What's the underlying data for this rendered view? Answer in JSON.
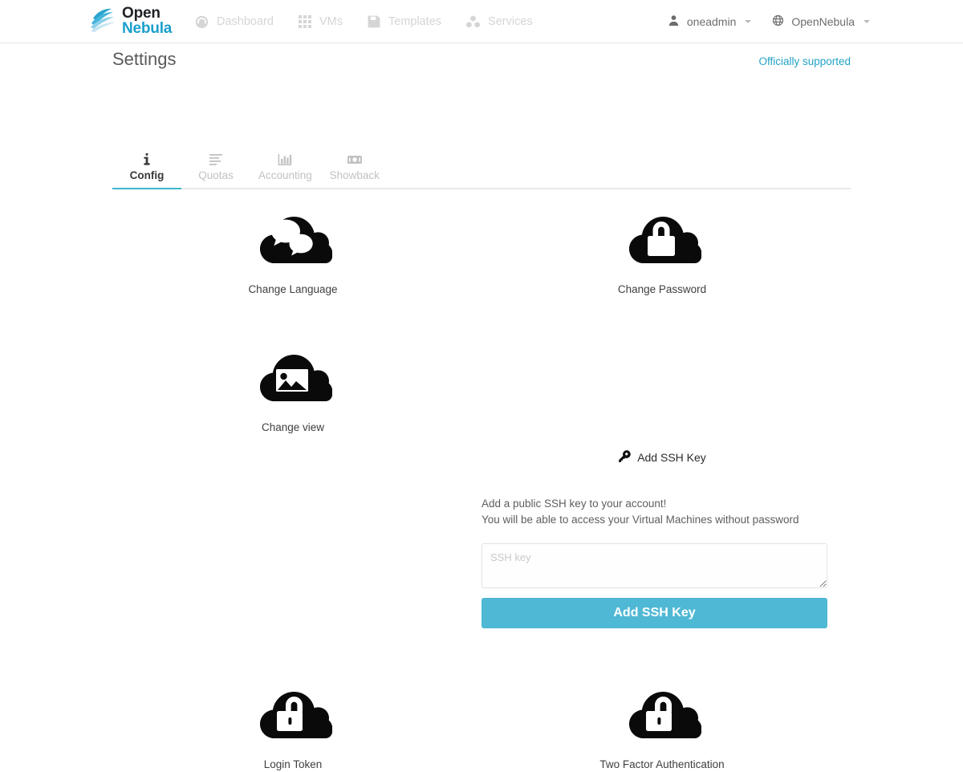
{
  "header": {
    "brand": {
      "logo_icon": "opennebula-cloud-swoosh-logo",
      "line1": "Open",
      "line2": "Nebula",
      "color_open": "#1f2124",
      "color_nebula": "#1aa0cc"
    },
    "nav": [
      {
        "label": "Dashboard",
        "icon": "dashboard-gauge-icon"
      },
      {
        "label": "VMs",
        "icon": "grid-squares-icon"
      },
      {
        "label": "Templates",
        "icon": "floppy-save-icon"
      },
      {
        "label": "Services",
        "icon": "cubes-cluster-icon"
      }
    ],
    "user": {
      "label": "oneadmin",
      "icon": "person-icon"
    },
    "group": {
      "label": "OpenNebula",
      "icon": "globe-icon"
    }
  },
  "page": {
    "title": "Settings",
    "support_label": "Officially supported",
    "support_color": "#22a3c4"
  },
  "tabs": [
    {
      "label": "Config",
      "icon": "info-i-icon",
      "active": true
    },
    {
      "label": "Quotas",
      "icon": "list-lines-icon",
      "active": false
    },
    {
      "label": "Accounting",
      "icon": "bar-chart-icon",
      "active": false
    },
    {
      "label": "Showback",
      "icon": "money-bill-icon",
      "active": false
    }
  ],
  "tab_accent_color": "#3db8cc",
  "cards": {
    "change_language": {
      "label": "Change Language",
      "icon": "cloud-chat-bubbles-icon"
    },
    "change_password": {
      "label": "Change Password",
      "icon": "cloud-closed-padlock-icon"
    },
    "change_view": {
      "label": "Change view",
      "icon": "cloud-picture-icon"
    },
    "login_token": {
      "label": "Login Token",
      "icon": "cloud-open-padlock-icon"
    },
    "two_factor_auth": {
      "label": "Two Factor Authentication",
      "icon": "cloud-open-padlock-icon"
    }
  },
  "ssh": {
    "heading": "Add SSH Key",
    "heading_icon": "key-icon",
    "description_line1": "Add a public SSH key to your account!",
    "description_line2": "You will be able to access your Virtual Machines without password",
    "textarea_placeholder": "SSH key",
    "textarea_value": "",
    "submit_label": "Add SSH Key",
    "submit_color": "#4fb8d4"
  }
}
